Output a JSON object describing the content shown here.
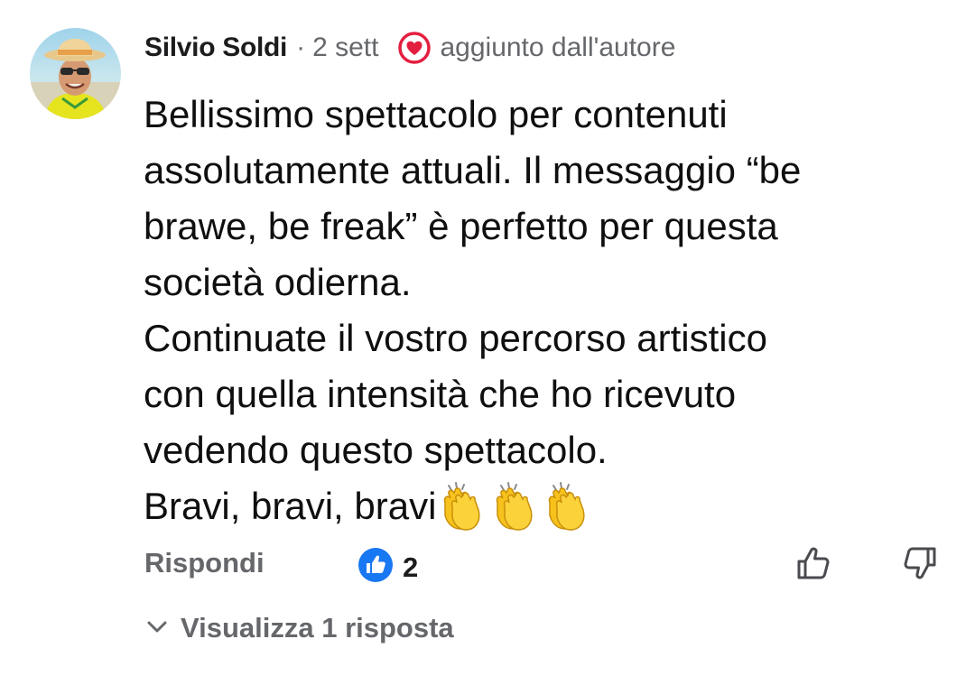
{
  "comment": {
    "author": "Silvio Soldi",
    "separator": "·",
    "time": "2 sett",
    "author_badge": "aggiunto dall'autore",
    "lines": [
      "Bellissimo spettacolo per contenuti",
      "assolutamente attuali. Il messaggio “be",
      "brawe, be freak” è perfetto per questa",
      "società odierna.",
      "Continuate il vostro percorso artistico",
      "con quella intensità che ho ricevuto",
      "vedendo questo spettacolo.",
      "Bravi, bravi, bravi"
    ],
    "emoji": [
      "clapping-hands",
      "clapping-hands",
      "clapping-hands"
    ]
  },
  "actions": {
    "reply_label": "Rispondi",
    "reaction_icon": "like-badge",
    "reaction_count": "2",
    "thumb_up_icon": "thumb-up",
    "thumb_down_icon": "thumb-down"
  },
  "replies": {
    "toggle_label": "Visualizza 1 risposta",
    "toggle_icon": "chevron-down"
  },
  "colors": {
    "text_primary": "#0f0f0f",
    "text_secondary": "#65676b",
    "heart_red": "#e41e3f",
    "like_blue": "#1877f2",
    "clap_yellow": "#f7c21c"
  }
}
